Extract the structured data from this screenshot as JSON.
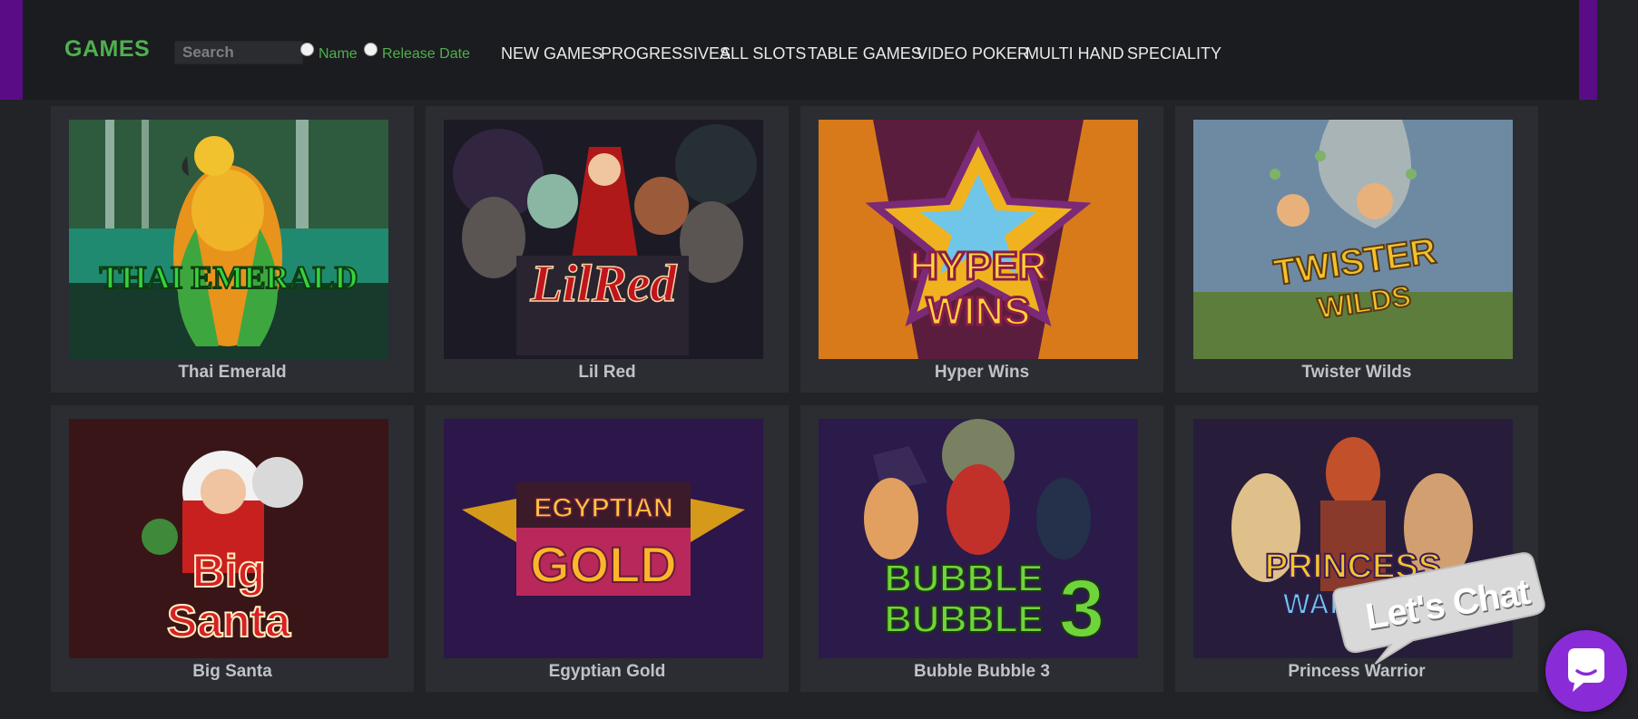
{
  "header": {
    "logo": "GAMES",
    "search_placeholder": "Search",
    "sort_options": [
      "Name",
      "Release Date"
    ],
    "nav": [
      "NEW GAMES",
      "PROGRESSIVES",
      "ALL SLOTS",
      "TABLE GAMES",
      "VIDEO POKER",
      "MULTI HAND",
      "SPECIALITY"
    ]
  },
  "games": [
    {
      "title": "Thai Emerald",
      "art_text": "THAI EMERALD"
    },
    {
      "title": "Lil Red",
      "art_text": "LilRed"
    },
    {
      "title": "Hyper Wins",
      "art_text": "HYPER WINS"
    },
    {
      "title": "Twister Wilds",
      "art_text": "TWISTER WILDS"
    },
    {
      "title": "Big Santa",
      "art_text": "Big Santa"
    },
    {
      "title": "Egyptian Gold",
      "art_text": "EGYPTIAN GOLD"
    },
    {
      "title": "Bubble Bubble 3",
      "art_text": "BUBBLE BUBBLE 3"
    },
    {
      "title": "Princess Warrior",
      "art_text": "PRINCESS WARRIOR"
    }
  ],
  "chat": {
    "label": "Let's Chat"
  },
  "colors": {
    "accent_green": "#4fb04f",
    "accent_purple": "#5a0c86",
    "chat_purple": "#8a2bd8"
  }
}
